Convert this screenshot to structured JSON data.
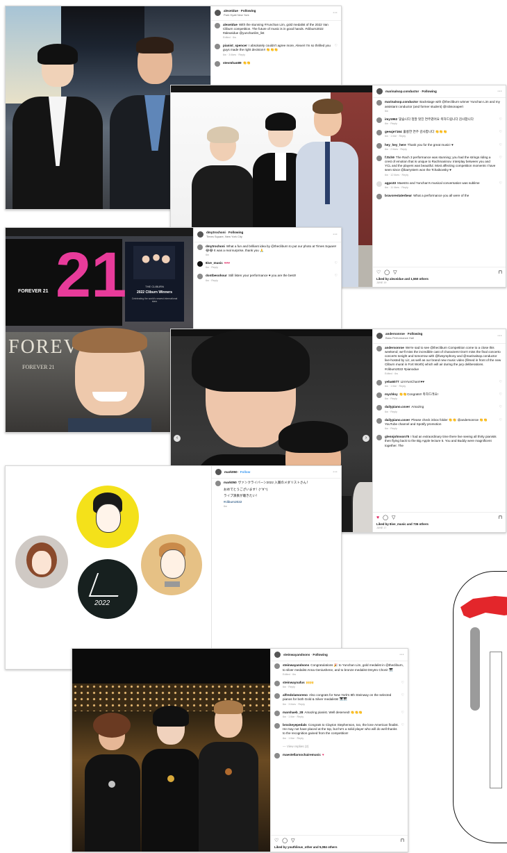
{
  "post1": {
    "user": "alexeidue",
    "follow": "Following",
    "location": "Park Hyatt New York",
    "caption_user": "alexeidue",
    "caption": "With the stunning #Yunchan Lim, gold medalist of the 2022 Van Cliburn competition. The future of music is in good hands. #cliburn2022 #alexeidue @yunchanlim_list",
    "caption_meta": "Edited · 6w",
    "comments": [
      {
        "user": "pianist_spencer",
        "text": "I absolutely couldn't agree more, Alexei! I'm so thrilled you guys made the right decision!! 👏👏👏",
        "meta": "6w · 3 likes · Reply"
      },
      {
        "user": "stevmhan89",
        "text": "👏👏",
        "meta": ""
      }
    ]
  },
  "post2": {
    "user": "marinalsop.conductor",
    "follow": "Following",
    "caption_user": "marinalsop.conductor",
    "caption": "Backstage with @thecliburn winner Yunchan Lim and my assistant conductor (and former student) @robsonapert",
    "caption_meta": "6w",
    "comments": [
      {
        "user": "imy1962",
        "text": "맞습니다 정말 멋진 연주였어요 축하드립니다 감사합니다",
        "meta": "6w · Reply"
      },
      {
        "user": "geeaje7164",
        "text": "훌륭한 연주 감사합니다 👏👏👏",
        "meta": "6w · 1 like · Reply"
      },
      {
        "user": "hey_hey_here",
        "text": "Thank you for the great music! ♥",
        "meta": "6w · 2 likes · Reply"
      },
      {
        "user": "f.ttch9",
        "text": "The Rach 3 performance was stunning; you had the strings riding a crest of emotion that is unique to Rachmaninov. Interplay between you and YCL and the players was beautiful. Most affecting competition moments I have seen since @barrystern won the Tchaikovsky ♥",
        "meta": "6w · 12 likes · Reply"
      },
      {
        "user": "agpo33",
        "text": "Maestro and Yunchan's musical conversation was sublime",
        "meta": "6w · 11 likes · Reply"
      },
      {
        "user": "bravorestaterbear",
        "text": "What a performance you all were of the",
        "meta": ""
      }
    ],
    "likes": "Liked by alexeidue and 1,550 others",
    "date": "JUNE 19"
  },
  "post3": {
    "user": "dmytrochoni",
    "follow": "Following",
    "location": "Times Square, New York City",
    "caption_user": "dmytrochoni",
    "caption": "What a fun and brilliant idea by @thecliburn to put our photo at Times Square! 😂😂 It was a real surprise, thank you 🙏",
    "caption_meta": "6w",
    "comments": [
      {
        "user": "8ive_music",
        "text": "♥♥♥",
        "meta": "6w · Reply"
      },
      {
        "user": "dontbesohour",
        "text": "Still listen your performance ♥ you are the best!!",
        "meta": "6w · Reply"
      }
    ],
    "billboard_21": "21",
    "billboard_forever": "FOREVER 21",
    "store_sign": "FOREVER",
    "store_sign_small": "FOREVER 21",
    "billboard_brand": "THE CLIBURN",
    "billboard_title": "2022 Cliburn Winners",
    "billboard_sub": "Celebrating the world's newest international stars"
  },
  "post4": {
    "user": "andersonroe",
    "follow": "Following",
    "location": "Bass Performance Hall",
    "caption_user": "andersonroe",
    "caption": "We're sad to see @thecliburn Competition come to a close this weekend; we'll miss the incredible cast of characters! Don't miss the final concerto concerts tonight and tomorrow with @fwsymphony and @marinalsop.conductor live-hosted by Liz, as well as our brand new music video (filmed in front of the new Cliburn mural in Fort Worth) which will air during the jury deliberations. #cliburn2022 #pianodue",
    "caption_meta": "Edited · 6w",
    "comments": [
      {
        "user": "yeba6077",
        "text": "LimYunChan!!♥♥",
        "meta": "6w · 1 like · Reply"
      },
      {
        "user": "mychloy",
        "text": "👏👏Congrats!! 축하드려요!",
        "meta": "6w · Reply"
      },
      {
        "user": "dailypiano.cover",
        "text": "Amazing",
        "meta": "6w · Reply"
      },
      {
        "user": "dailypiano.cover",
        "text": "Please check inbox folder 👏👏 @andersonroe 👏👏 YouTube channel and Spotify promotion",
        "meta": "6w · Reply"
      },
      {
        "user": "glennjohnson75",
        "text": "I had an extraordinary time there live seeing all thirty pianists then flying back to the Big Apple lecture 5. You and Buddy were magnificent together. The",
        "meta": ""
      }
    ],
    "likes": "Liked by 8ive_music and 736 others",
    "date": "JUNE 17"
  },
  "post5": {
    "user": "mark050",
    "follow": "Follow",
    "caption_user": "mark050",
    "caption": "ヴァンクライバーン2022 入賞のメダリストさん！",
    "lines": [
      "おめでとうございます！(*´∀`*)",
      "ライブ演奏が聴きたい！",
      "#cliburn2022"
    ],
    "caption_meta": "6w",
    "illustration_year": "2022"
  },
  "post6": {
    "user": "steinwayandsons",
    "follow": "Following",
    "caption_user": "steinwayandsons",
    "caption": "Congratulations 🎉 to Yunchan Lim, gold medalist in @thecliburn, to silver medalist Anna Geniushene, and to bronze medalist Dmytro Choni! 🎹",
    "caption_meta": "Edited · 6w",
    "comments": [
      {
        "user": "steinwaynafus",
        "text": "🙌🙌",
        "meta": "6w · Reply"
      },
      {
        "user": "alfredolamoreno",
        "text": "Also congrats for New York's 8th Steinway on the selected pianos for both Gold & Silver medalists! 🎹🎹",
        "meta": "6w · 3 likes · Reply"
      },
      {
        "user": "marshaeb_28",
        "text": "Amazing pianist. Well deserved! 👏👏👏",
        "meta": "6w · 1 like · Reply"
      },
      {
        "user": "brockeyepedals",
        "text": "Congrats to Clayton Stephenson, too, the lone American finalist. He may not have placed at the top, but he's a solid player who will do well thanks to the recognition gained from the competition!",
        "meta": "6w · 1 like · Reply"
      },
      {
        "user": "",
        "text": "— View replies (2)",
        "meta": ""
      },
      {
        "user": "maestellarsochairemusic",
        "text": "♥",
        "meta": ""
      }
    ],
    "likes": "Liked by youthlinus_other and 5,084 others"
  },
  "icons": {
    "heart_outline": "♡",
    "heart_filled": "♥",
    "comment": "◯",
    "send": "▽",
    "save": "⊓",
    "more": "···",
    "prev": "‹",
    "next": "›"
  },
  "colors": {
    "like_red": "#e0245e",
    "verified": "#3897f0"
  }
}
